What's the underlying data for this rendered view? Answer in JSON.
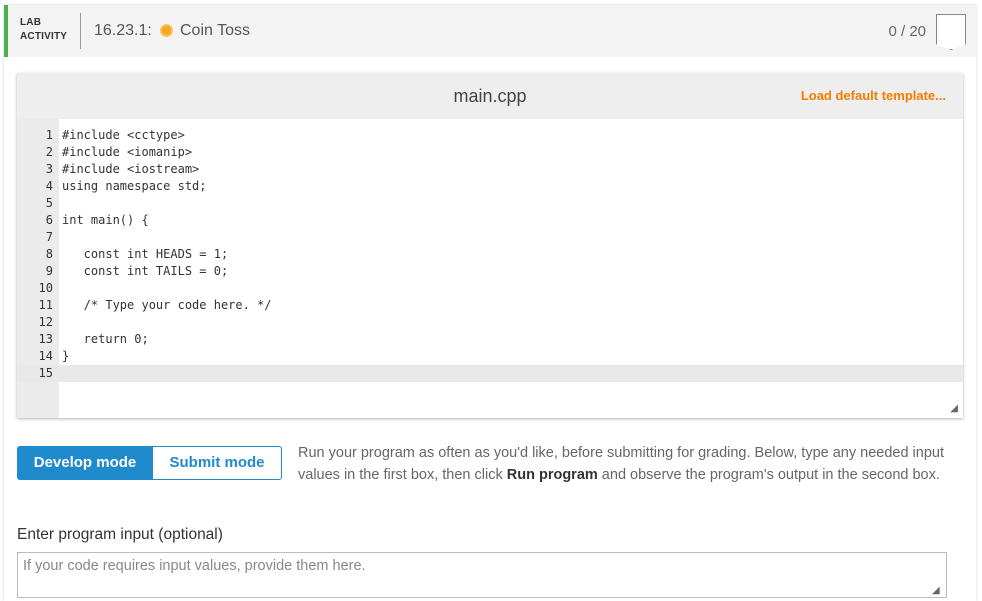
{
  "header": {
    "tag_line1": "LAB",
    "tag_line2": "ACTIVITY",
    "number": "16.23.1:",
    "coin_icon": "coin-icon",
    "title": "Coin Toss",
    "score": "0 / 20",
    "accent_color": "#4caf50"
  },
  "editor": {
    "file_name": "main.cpp",
    "load_template_label": "Load default template...",
    "active_line": 15,
    "lines": [
      {
        "n": "1",
        "text": "#include <cctype>"
      },
      {
        "n": "2",
        "text": "#include <iomanip>"
      },
      {
        "n": "3",
        "text": "#include <iostream>"
      },
      {
        "n": "4",
        "text": "using namespace std;"
      },
      {
        "n": "5",
        "text": ""
      },
      {
        "n": "6",
        "text": "int main() {"
      },
      {
        "n": "7",
        "text": ""
      },
      {
        "n": "8",
        "text": "   const int HEADS = 1;"
      },
      {
        "n": "9",
        "text": "   const int TAILS = 0;"
      },
      {
        "n": "10",
        "text": ""
      },
      {
        "n": "11",
        "text": "   /* Type your code here. */"
      },
      {
        "n": "12",
        "text": ""
      },
      {
        "n": "13",
        "text": "   return 0;"
      },
      {
        "n": "14",
        "text": "}"
      },
      {
        "n": "15",
        "text": ""
      }
    ]
  },
  "modes": {
    "develop_label": "Develop mode",
    "submit_label": "Submit mode",
    "selected": "Develop mode"
  },
  "instructions": {
    "part1": "Run your program as often as you'd like, before submitting for grading. Below, type any needed input values in the first box, then click ",
    "bold": "Run program",
    "part2": " and observe the program's output in the second box."
  },
  "program_input": {
    "label": "Enter program input (optional)",
    "placeholder": "If your code requires input values, provide them here.",
    "value": ""
  },
  "colors": {
    "primary": "#1f8acc",
    "template_link": "#f57c00",
    "coin": "#f5a623"
  }
}
